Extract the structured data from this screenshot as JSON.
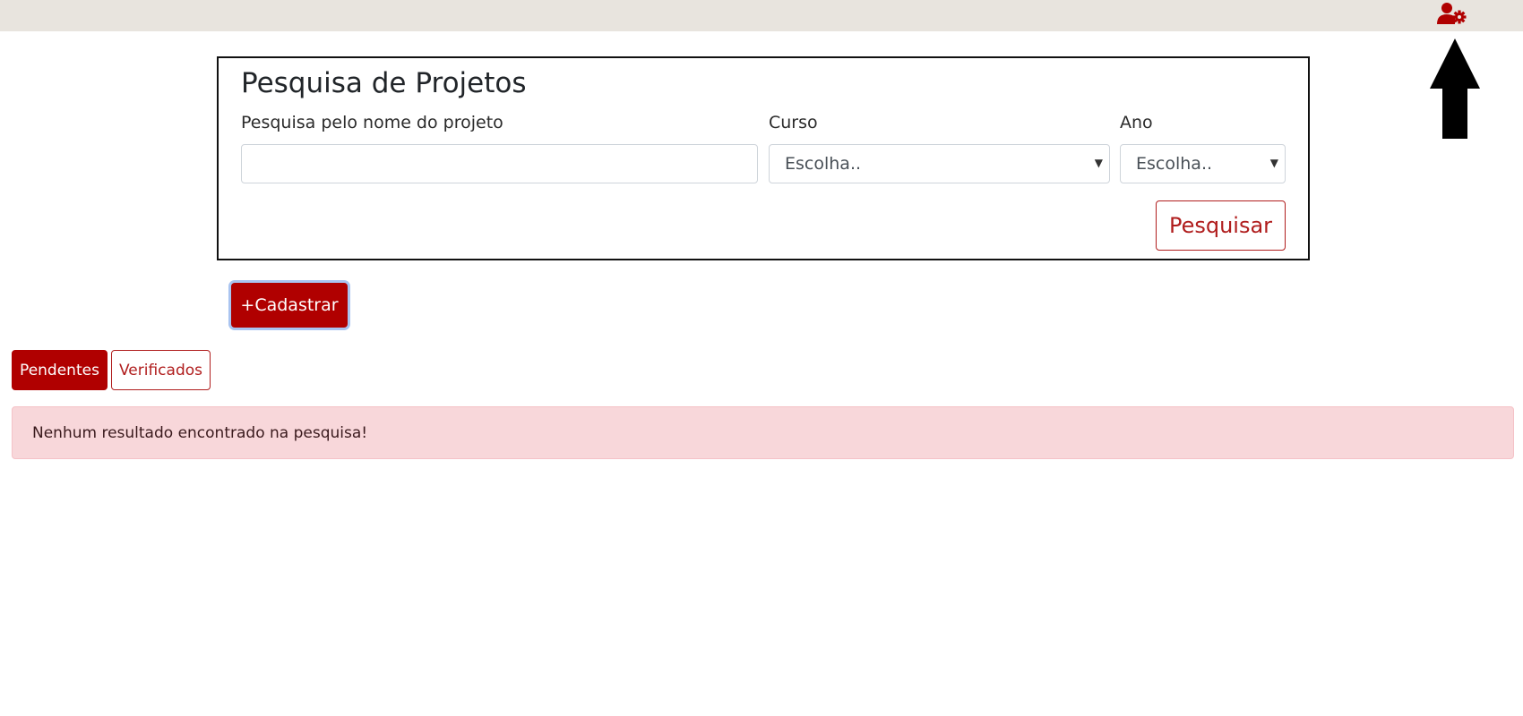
{
  "header": {
    "user_icon": "user-gear-icon",
    "accent_color": "#b00000",
    "annotation_icon": "arrow-up-icon"
  },
  "search": {
    "title": "Pesquisa de Projetos",
    "name_label": "Pesquisa pelo nome do projeto",
    "name_value": "",
    "curso_label": "Curso",
    "curso_value": "Escolha..",
    "ano_label": "Ano",
    "ano_value": "Escolha..",
    "submit_label": "Pesquisar"
  },
  "actions": {
    "cadastrar_label": "+Cadastrar"
  },
  "tabs": [
    {
      "label": "Pendentes",
      "active": true
    },
    {
      "label": "Verificados",
      "active": false
    }
  ],
  "results": {
    "message": "Nenhum resultado encontrado na pesquisa!"
  }
}
